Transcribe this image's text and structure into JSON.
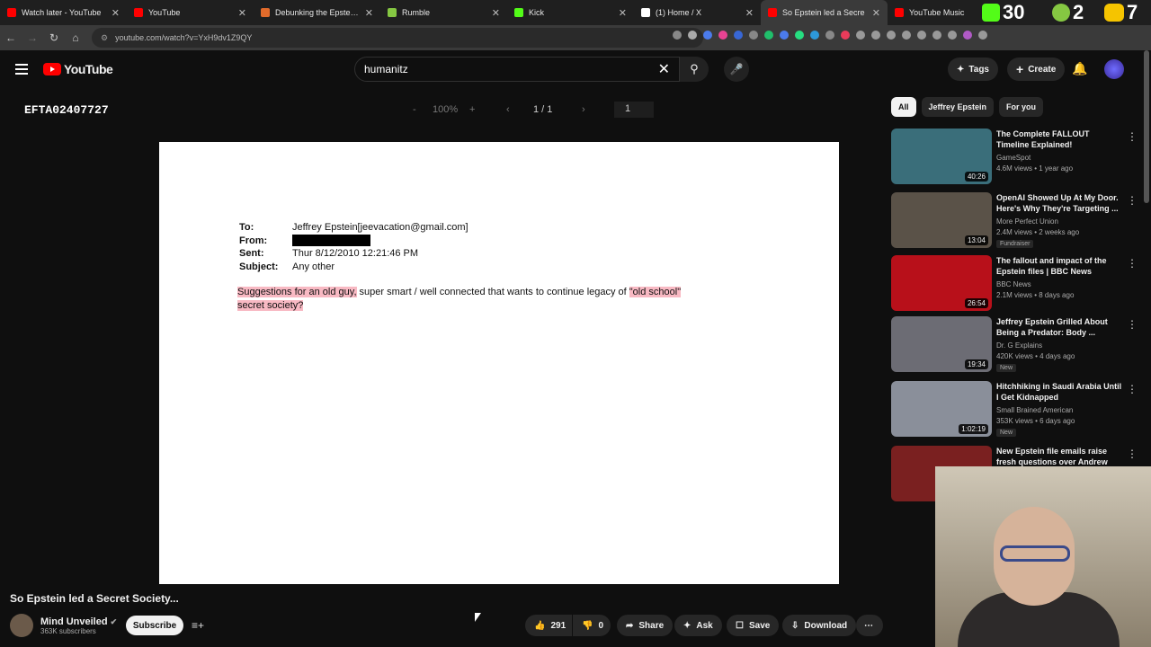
{
  "browser": {
    "tabs": [
      {
        "title": "Watch later - YouTube",
        "color": "#ff0000"
      },
      {
        "title": "YouTube",
        "color": "#ff0000"
      },
      {
        "title": "Debunking the Epstein My",
        "color": "#e26b2b"
      },
      {
        "title": "Rumble",
        "color": "#85c742"
      },
      {
        "title": "Kick",
        "color": "#53fc18"
      },
      {
        "title": "(1) Home / X",
        "color": "#ffffff"
      },
      {
        "title": "So Epstein led a Secre",
        "color": "#ff0000"
      },
      {
        "title": "YouTube Music",
        "color": "#ff0000"
      }
    ],
    "ext_counters": {
      "kick": "30",
      "rumble": "2",
      "other": "7"
    },
    "url": "youtube.com/watch?v=YxH9dv1Z9QY"
  },
  "header": {
    "logo": "YouTube",
    "search_value": "humanitz",
    "tags_label": "Tags",
    "create_label": "Create"
  },
  "pdf": {
    "doc_title": "EFTA02407727",
    "zoom_minus": "-",
    "zoom": "100%",
    "zoom_plus": "+",
    "page_indicator": "1 / 1",
    "page_input": "1",
    "email": {
      "to_label": "To:",
      "to_value": "Jeffrey Epstein[jeevacation@gmail.com]",
      "from_label": "From:",
      "sent_label": "Sent:",
      "sent_value": "Thur 8/12/2010 12:21:46 PM",
      "subject_label": "Subject:",
      "subject_value": "Any other",
      "body_hl1": "Suggestions for an old guy,",
      "body_mid": " super smart / well connected that wants to continue legacy of ",
      "body_hl2": "\"old school\"",
      "body_hl3": "secret society?"
    }
  },
  "video": {
    "title": "So Epstein led a Secret Society...",
    "channel": "Mind Unveiled",
    "subscribers": "363K subscribers",
    "subscribe_label": "Subscribe",
    "likes": "291",
    "dislikes": "0",
    "share_label": "Share",
    "ask_label": "Ask",
    "save_label": "Save",
    "download_label": "Download"
  },
  "sidebar": {
    "chips": [
      "All",
      "Jeffrey Epstein",
      "For you"
    ],
    "recs": [
      {
        "title": "The Complete FALLOUT Timeline Explained!",
        "channel": "GameSpot",
        "meta": "4.6M views • 1 year ago",
        "duration": "40:26",
        "badge": "",
        "thumb": "#3a6e7a"
      },
      {
        "title": "OpenAI Showed Up At My Door. Here's Why They're Targeting ...",
        "channel": "More Perfect Union",
        "meta": "2.4M views • 2 weeks ago",
        "duration": "13:04",
        "badge": "Fundraiser",
        "thumb": "#5a5248"
      },
      {
        "title": "The fallout and impact of the Epstein files | BBC News",
        "channel": "BBC News",
        "meta": "2.1M views • 8 days ago",
        "duration": "26:54",
        "badge": "",
        "thumb": "#b8101a"
      },
      {
        "title": "Jeffrey Epstein Grilled About Being a Predator: Body ...",
        "channel": "Dr. G Explains",
        "meta": "420K views • 4 days ago",
        "duration": "19:34",
        "badge": "New",
        "thumb": "#6c6c74"
      },
      {
        "title": "Hitchhiking in Saudi Arabia Until I Get Kidnapped",
        "channel": "Small Brained American",
        "meta": "353K views • 6 days ago",
        "duration": "1:02:19",
        "badge": "New",
        "thumb": "#8a8f9a"
      },
      {
        "title": "New Epstein file emails raise fresh questions over Andrew",
        "channel": "",
        "meta": "",
        "duration": "",
        "badge": "",
        "thumb": "#7a2020"
      }
    ]
  }
}
